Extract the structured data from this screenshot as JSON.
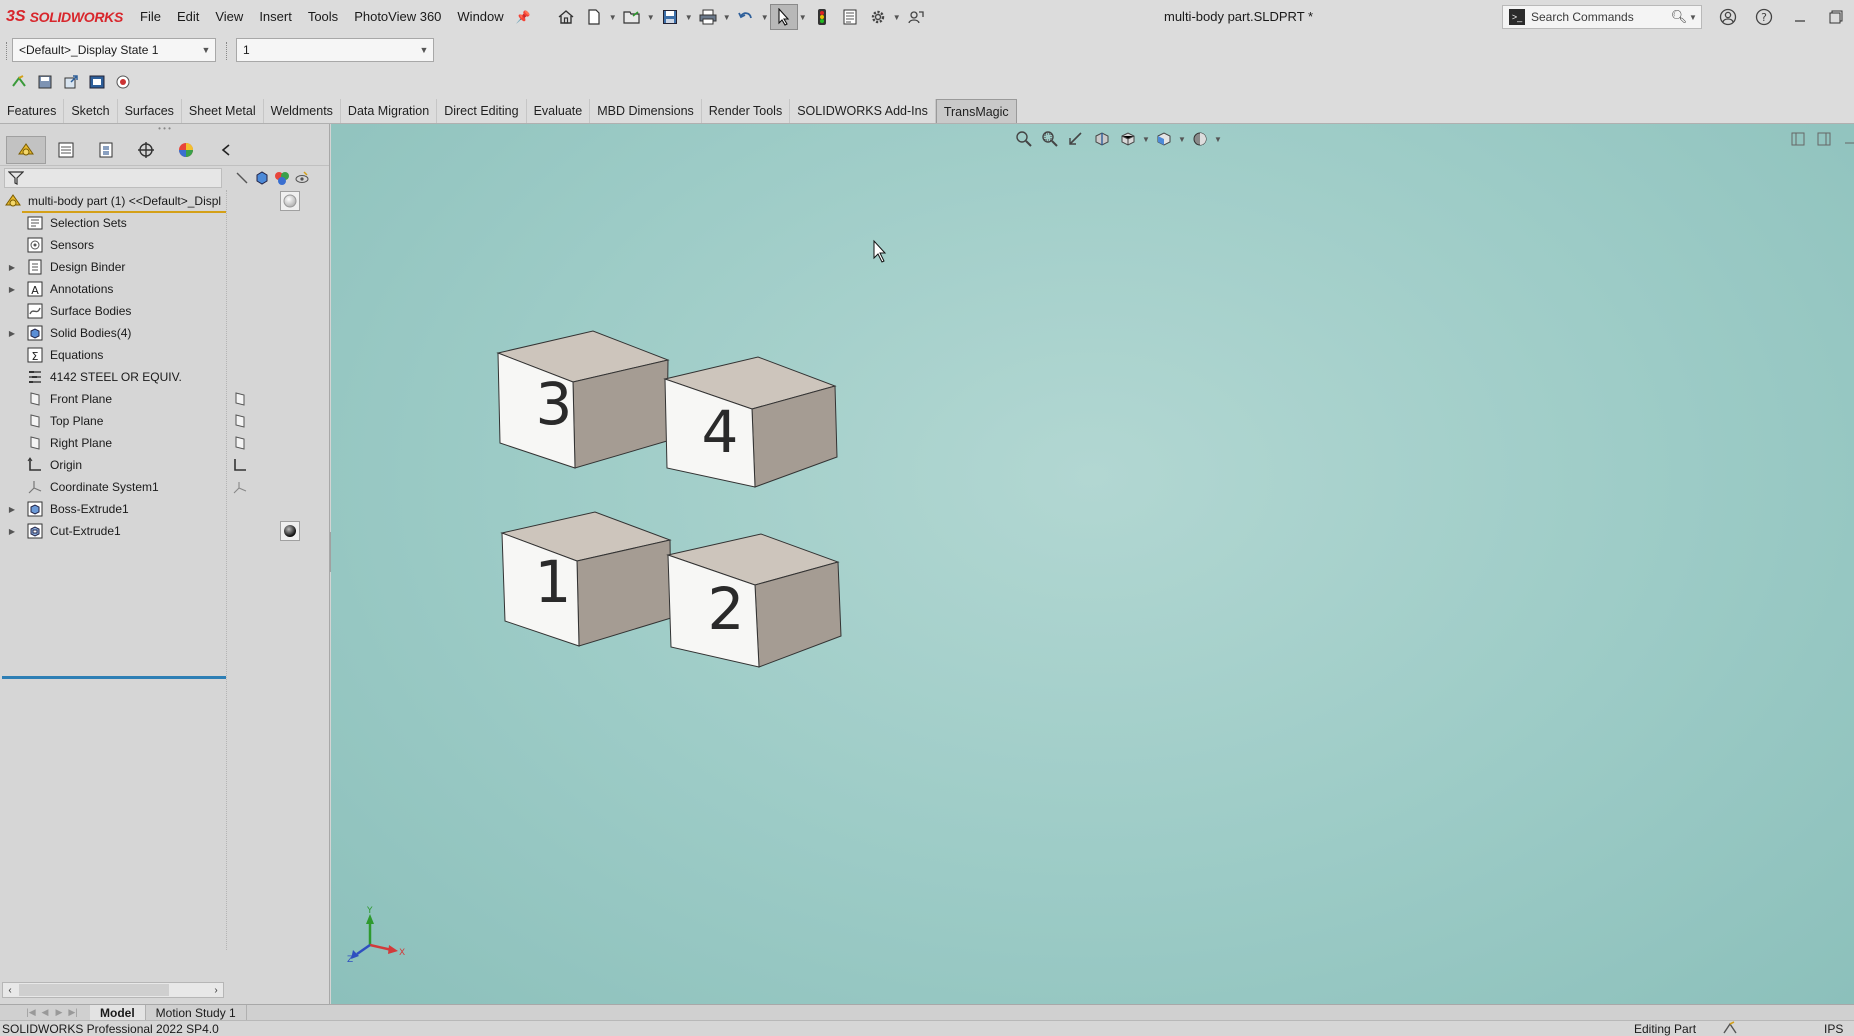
{
  "app": {
    "logo_mark": "3S",
    "logo_text": "SOLIDWORKS",
    "document_title": "multi-body part.SLDPRT *"
  },
  "menu": [
    "File",
    "Edit",
    "View",
    "Insert",
    "Tools",
    "PhotoView 360",
    "Window"
  ],
  "search": {
    "placeholder": "Search Commands"
  },
  "config": {
    "display_state": "<Default>_Display State 1",
    "second_combo": "1"
  },
  "tabs": [
    {
      "label": "Features"
    },
    {
      "label": "Sketch"
    },
    {
      "label": "Surfaces"
    },
    {
      "label": "Sheet Metal"
    },
    {
      "label": "Weldments"
    },
    {
      "label": "Data Migration"
    },
    {
      "label": "Direct Editing"
    },
    {
      "label": "Evaluate"
    },
    {
      "label": "MBD Dimensions"
    },
    {
      "label": "Render Tools"
    },
    {
      "label": "SOLIDWORKS Add-Ins"
    },
    {
      "label": "TransMagic",
      "active": true
    }
  ],
  "tree": {
    "root": "multi-body part (1) <<Default>_Displ",
    "items": [
      {
        "label": "Selection Sets",
        "icon": "selection-sets-icon",
        "expandable": false
      },
      {
        "label": "Sensors",
        "icon": "sensors-icon",
        "expandable": false
      },
      {
        "label": "Design Binder",
        "icon": "design-binder-icon",
        "expandable": true
      },
      {
        "label": "Annotations",
        "icon": "annotations-icon",
        "expandable": true
      },
      {
        "label": "Surface Bodies",
        "icon": "surface-bodies-icon",
        "expandable": false
      },
      {
        "label": "Solid Bodies(4)",
        "icon": "solid-bodies-icon",
        "expandable": true
      },
      {
        "label": "Equations",
        "icon": "equations-icon",
        "expandable": false
      },
      {
        "label": "4142 STEEL OR EQUIV.",
        "icon": "material-icon",
        "expandable": false
      },
      {
        "label": "Front Plane",
        "icon": "plane-icon",
        "expandable": false
      },
      {
        "label": "Top Plane",
        "icon": "plane-icon",
        "expandable": false
      },
      {
        "label": "Right Plane",
        "icon": "plane-icon",
        "expandable": false
      },
      {
        "label": "Origin",
        "icon": "origin-icon",
        "expandable": false
      },
      {
        "label": "Coordinate System1",
        "icon": "coordinate-system-icon",
        "expandable": false
      },
      {
        "label": "Boss-Extrude1",
        "icon": "boss-extrude-icon",
        "expandable": true
      },
      {
        "label": "Cut-Extrude1",
        "icon": "cut-extrude-icon",
        "expandable": true
      }
    ]
  },
  "bodies": [
    "3",
    "4",
    "1",
    "2"
  ],
  "triad": {
    "x": "X",
    "y": "Y",
    "z": "Z"
  },
  "bottom_tabs": [
    "Model",
    "Motion Study 1"
  ],
  "status": {
    "left": "SOLIDWORKS Professional 2022 SP4.0",
    "editing": "Editing Part",
    "units": "IPS"
  },
  "colors": {
    "viewport": "#9ccbc6",
    "brand": "#d8262c",
    "rollback_bar": "#2e7fb5",
    "root_underline": "#d4a018",
    "cube_face": "#f7f7f5",
    "cube_top": "#cdc5bc",
    "cube_side": "#a59c93"
  }
}
